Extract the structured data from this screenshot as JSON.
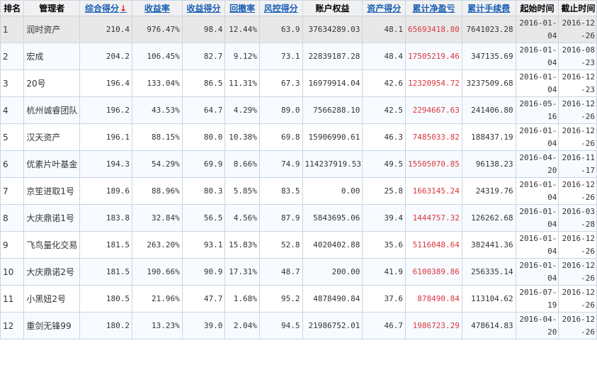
{
  "headers": [
    "排名",
    "管理者",
    "综合得分",
    "收益率",
    "收益得分",
    "回撤率",
    "风控得分",
    "账户权益",
    "资产得分",
    "累计净盈亏",
    "累计手续费",
    "起始时间",
    "截止时间"
  ],
  "sort_arrow": "↓",
  "rows": [
    {
      "rank": "1",
      "manager": "润时资产",
      "score": "210.4",
      "return_rate": "976.47%",
      "return_score": "98.4",
      "drawdown": "12.44%",
      "risk_score": "63.9",
      "equity": "37634289.03",
      "asset_score": "48.1",
      "net_pnl": "65693418.80",
      "fees": "7641023.28",
      "start": "2016-01-04",
      "end": "2016-12-26"
    },
    {
      "rank": "2",
      "manager": "宏成",
      "score": "204.2",
      "return_rate": "106.45%",
      "return_score": "82.7",
      "drawdown": "9.12%",
      "risk_score": "73.1",
      "equity": "22839187.28",
      "asset_score": "48.4",
      "net_pnl": "17505219.46",
      "fees": "347135.69",
      "start": "2016-01-04",
      "end": "2016-08-23"
    },
    {
      "rank": "3",
      "manager": "20号",
      "score": "196.4",
      "return_rate": "133.04%",
      "return_score": "86.5",
      "drawdown": "11.31%",
      "risk_score": "67.3",
      "equity": "16979914.04",
      "asset_score": "42.6",
      "net_pnl": "12320954.72",
      "fees": "3237509.68",
      "start": "2016-01-04",
      "end": "2016-12-23"
    },
    {
      "rank": "4",
      "manager": "杭州诚睿团队",
      "score": "196.2",
      "return_rate": "43.53%",
      "return_score": "64.7",
      "drawdown": "4.29%",
      "risk_score": "89.0",
      "equity": "7566288.10",
      "asset_score": "42.5",
      "net_pnl": "2294667.63",
      "fees": "241406.80",
      "start": "2016-05-16",
      "end": "2016-12-26"
    },
    {
      "rank": "5",
      "manager": "汉天资产",
      "score": "196.1",
      "return_rate": "88.15%",
      "return_score": "80.0",
      "drawdown": "10.38%",
      "risk_score": "69.8",
      "equity": "15906990.61",
      "asset_score": "46.3",
      "net_pnl": "7485033.82",
      "fees": "188437.19",
      "start": "2016-01-04",
      "end": "2016-12-26"
    },
    {
      "rank": "6",
      "manager": "优素片叶基金",
      "score": "194.3",
      "return_rate": "54.29%",
      "return_score": "69.9",
      "drawdown": "8.66%",
      "risk_score": "74.9",
      "equity": "114237919.53",
      "asset_score": "49.5",
      "net_pnl": "15505070.85",
      "fees": "96138.23",
      "start": "2016-04-20",
      "end": "2016-11-17"
    },
    {
      "rank": "7",
      "manager": "京笙进取1号",
      "score": "189.6",
      "return_rate": "88.96%",
      "return_score": "80.3",
      "drawdown": "5.85%",
      "risk_score": "83.5",
      "equity": "0.00",
      "asset_score": "25.8",
      "net_pnl": "1663145.24",
      "fees": "24319.76",
      "start": "2016-01-04",
      "end": "2016-12-26"
    },
    {
      "rank": "8",
      "manager": "大庆鼎诺1号",
      "score": "183.8",
      "return_rate": "32.84%",
      "return_score": "56.5",
      "drawdown": "4.56%",
      "risk_score": "87.9",
      "equity": "5843695.06",
      "asset_score": "39.4",
      "net_pnl": "1444757.32",
      "fees": "126262.68",
      "start": "2016-01-04",
      "end": "2016-03-28"
    },
    {
      "rank": "9",
      "manager": "飞鸟量化交易",
      "score": "181.5",
      "return_rate": "263.20%",
      "return_score": "93.1",
      "drawdown": "15.83%",
      "risk_score": "52.8",
      "equity": "4020402.88",
      "asset_score": "35.6",
      "net_pnl": "5116048.64",
      "fees": "382441.36",
      "start": "2016-01-04",
      "end": "2016-12-26"
    },
    {
      "rank": "10",
      "manager": "大庆鼎诺2号",
      "score": "181.5",
      "return_rate": "190.66%",
      "return_score": "90.9",
      "drawdown": "17.31%",
      "risk_score": "48.7",
      "equity": "200.00",
      "asset_score": "41.9",
      "net_pnl": "6100389.86",
      "fees": "256335.14",
      "start": "2016-01-04",
      "end": "2016-12-26"
    },
    {
      "rank": "11",
      "manager": "小黑妞2号",
      "score": "180.5",
      "return_rate": "21.96%",
      "return_score": "47.7",
      "drawdown": "1.68%",
      "risk_score": "95.2",
      "equity": "4878490.84",
      "asset_score": "37.6",
      "net_pnl": "878490.84",
      "fees": "113104.62",
      "start": "2016-07-19",
      "end": "2016-12-26"
    },
    {
      "rank": "12",
      "manager": "重剑无锋99",
      "score": "180.2",
      "return_rate": "13.23%",
      "return_score": "39.0",
      "drawdown": "2.04%",
      "risk_score": "94.5",
      "equity": "21986752.01",
      "asset_score": "46.7",
      "net_pnl": "1986723.29",
      "fees": "478614.83",
      "start": "2016-04-20",
      "end": "2016-12-26"
    }
  ],
  "colors": {
    "header_bg": "#f1f1f1",
    "link_blue": "#1a5fb4",
    "pnl_red": "#d9363e",
    "highlight_row": "#e8e8e8",
    "border": "#c9d6e2"
  }
}
